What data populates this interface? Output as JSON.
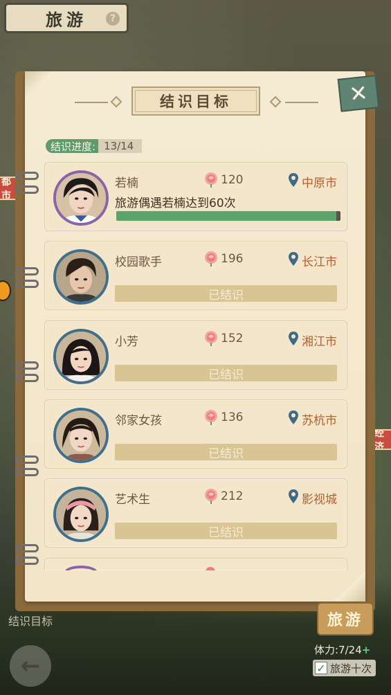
{
  "screen_title": "旅游",
  "help_icon": "?",
  "side_left_sign": "都市",
  "side_right_sign": "经济",
  "dialog": {
    "title": "结识目标",
    "close_icon": "close-icon",
    "progress_label": "结识进度:",
    "progress_value": "13/14"
  },
  "cards": [
    {
      "name": "若楠",
      "score": "120",
      "city": "中原市",
      "goal": "旅游偶遇若楠达到60次",
      "progress_fraction": 0.98,
      "status": ""
    },
    {
      "name": "校园歌手",
      "score": "196",
      "city": "长江市",
      "goal": "",
      "status": "已结识"
    },
    {
      "name": "小芳",
      "score": "152",
      "city": "湘江市",
      "goal": "",
      "status": "已结识"
    },
    {
      "name": "邻家女孩",
      "score": "136",
      "city": "苏杭市",
      "goal": "",
      "status": "已结识"
    },
    {
      "name": "艺术生",
      "score": "212",
      "city": "影视城",
      "goal": "",
      "status": "已结识"
    }
  ],
  "bottom": {
    "tab_label": "结识目标",
    "travel_button": "旅游",
    "stamina": "体力:7/24",
    "stamina_plus": "+",
    "travel_ten": "旅游十次",
    "travel_ten_checked": true
  },
  "colors": {
    "progress_green": "#5aa36c",
    "city_orange": "#b2612e",
    "avatar_border_blue": "#3f6f8a",
    "avatar_border_purple": "#8a64a8",
    "close_button": "#5f8474"
  }
}
